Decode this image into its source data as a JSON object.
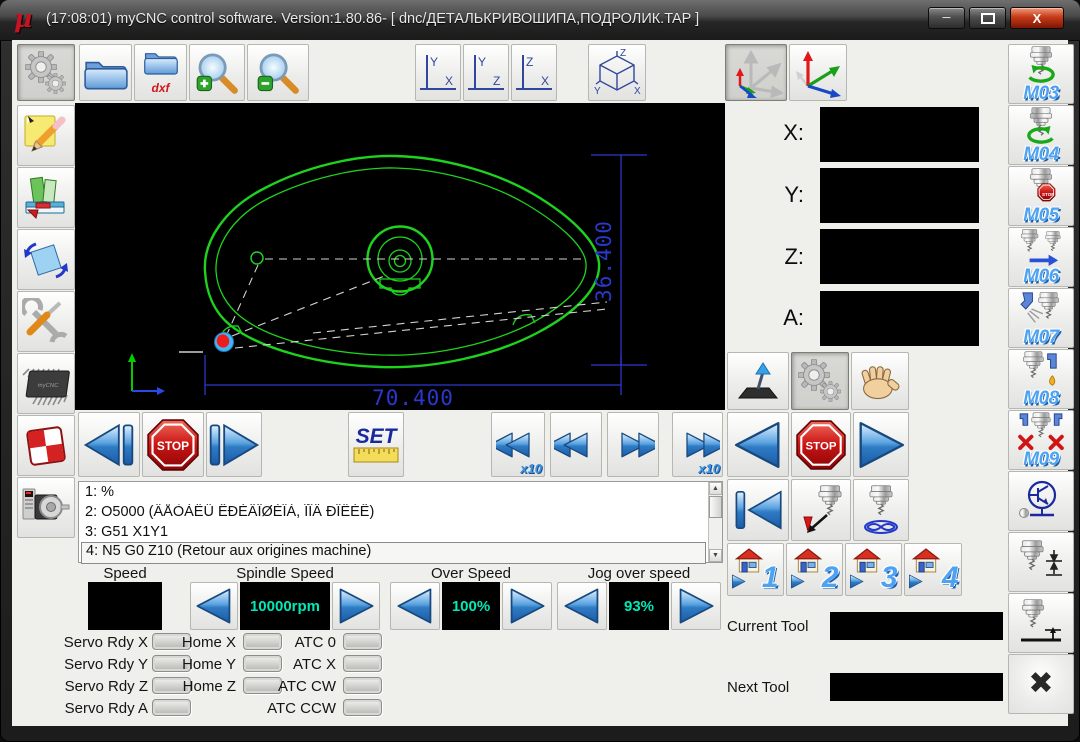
{
  "window": {
    "logo": "µ",
    "title": "(17:08:01)   myCNC control software. Version:1.80.86-   [ dnc/ДЕТАЛЬКРИВОШИПА,ПОДРОЛИК.TAP ]",
    "controls": {
      "minimize": "─",
      "close": "X"
    }
  },
  "icons": {
    "close_glyph": "✖",
    "scroll_up": "▲",
    "scroll_down": "▼",
    "dxf_label": "dxf"
  },
  "views": {
    "yx": {
      "v": "Y",
      "h": "X"
    },
    "yz": {
      "v": "Y",
      "h": "Z"
    },
    "zx": {
      "v": "Z",
      "h": "X"
    },
    "iso": {
      "top": "Z",
      "left": "Y",
      "right": "X"
    }
  },
  "coords": {
    "x": "X:",
    "y": "Y:",
    "z": "Z:",
    "a": "A:"
  },
  "mcodes": {
    "m03": "M03",
    "m04": "M04",
    "m05": "M05",
    "m06": "M06",
    "m07": "M07",
    "m08": "M08",
    "m09": "M09"
  },
  "transport": {
    "stop": "STOP",
    "set": "SET",
    "x10": "x10"
  },
  "gcode": {
    "lines": [
      "1: %",
      "2: O5000 (ÄÅÒÀËÜ ÊÐÈÂÎØÈÏÀ, ÏÎÄ ÐÎËÈÊ)",
      "3: G51 X1Y1",
      "4: N5 G0 Z10 (Retour aux origines machine)"
    ]
  },
  "speed": {
    "label": "Speed",
    "spindle_label": "Spindle Speed",
    "spindle_value": "10000rpm",
    "over_label": "Over Speed",
    "over_value": "100%",
    "jog_label": "Jog over speed",
    "jog_value": "93%"
  },
  "indicators": {
    "servo": [
      "Servo Rdy X",
      "Servo Rdy Y",
      "Servo Rdy Z",
      "Servo Rdy A"
    ],
    "home": [
      "Home X",
      "Home Y",
      "Home Z"
    ],
    "atc": [
      "ATC 0",
      "ATC X",
      "ATC CW",
      "ATC CCW"
    ]
  },
  "tools": {
    "current": "Current Tool",
    "next": "Next Tool"
  },
  "homes": [
    "1",
    "2",
    "3",
    "4"
  ],
  "drawing": {
    "dim_h": "70.400",
    "dim_v": "36.400"
  },
  "colors": {
    "accent_cyan": "#00e9b6",
    "dim_blue": "#2a38cc",
    "draw_green": "#1dd31d",
    "stop_red": "#c41414",
    "mlabel_blue": "#4da2f2"
  }
}
